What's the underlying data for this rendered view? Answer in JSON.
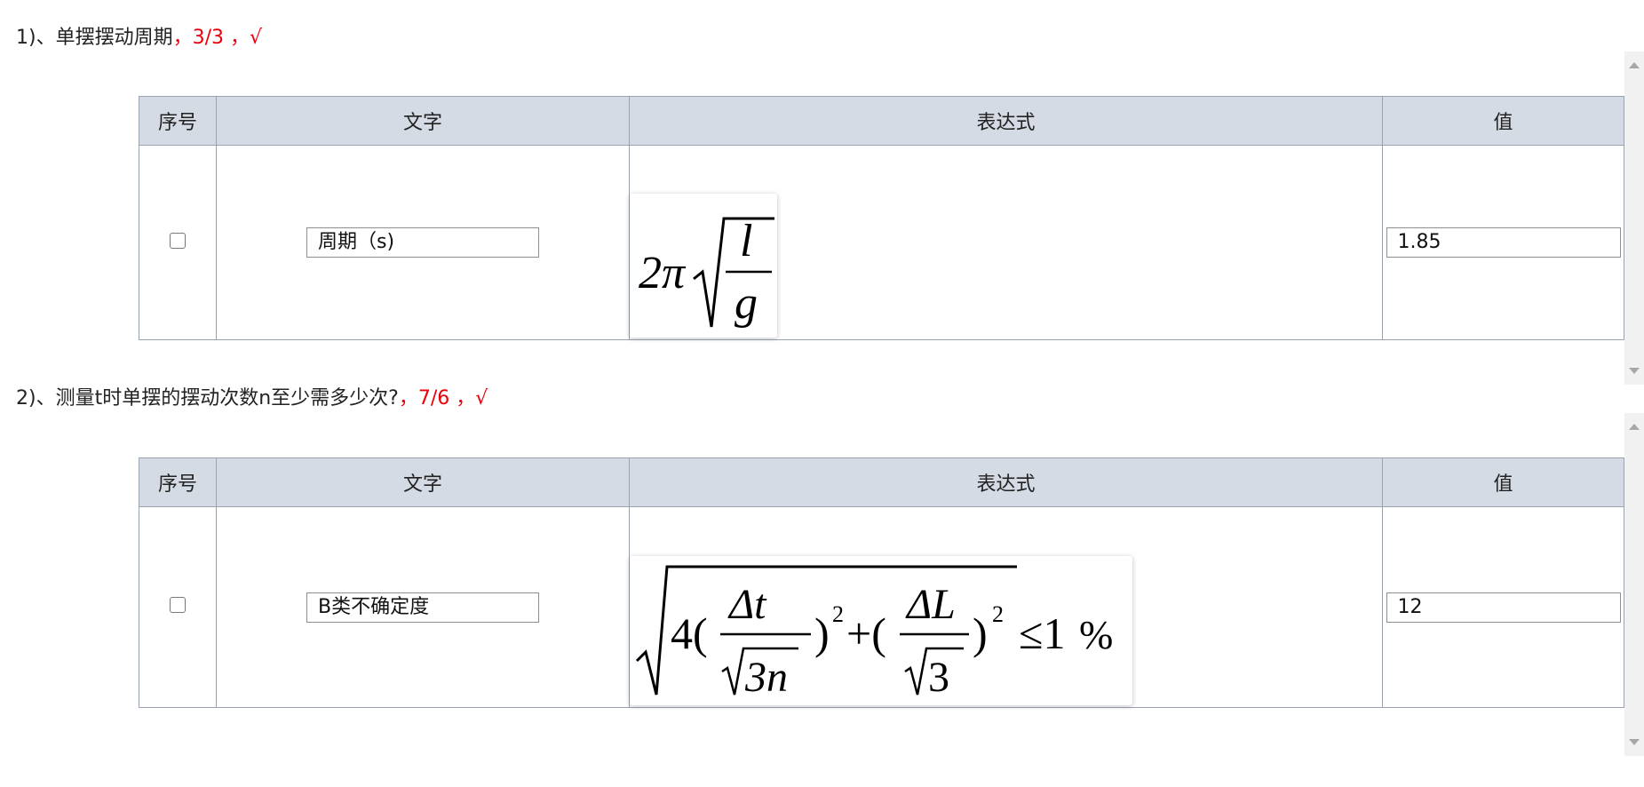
{
  "questions": [
    {
      "text": "1)、单摆摆动周期",
      "score": "，3/3 ，√",
      "table": {
        "headers": [
          "序号",
          "文字",
          "表达式",
          "值"
        ],
        "row": {
          "text_value": "周期（s)",
          "value": "1.85"
        }
      },
      "formula": {
        "coef": "2π",
        "num": "l",
        "den": "g"
      }
    },
    {
      "text": "2)、测量t时单摆的摆动次数n至少需多少次?",
      "score": "，7/6 ，√",
      "table": {
        "headers": [
          "序号",
          "文字",
          "表达式",
          "值"
        ],
        "row": {
          "text_value": "B类不确定度",
          "value": "12"
        }
      },
      "formula": {
        "four": "4(",
        "num1": "Δt",
        "den1": "3n",
        "close": ")",
        "exp": "2",
        "plus": "+(",
        "num2": "ΔL",
        "den2": "3",
        "leq": "≤1",
        "pct": "%"
      }
    }
  ]
}
